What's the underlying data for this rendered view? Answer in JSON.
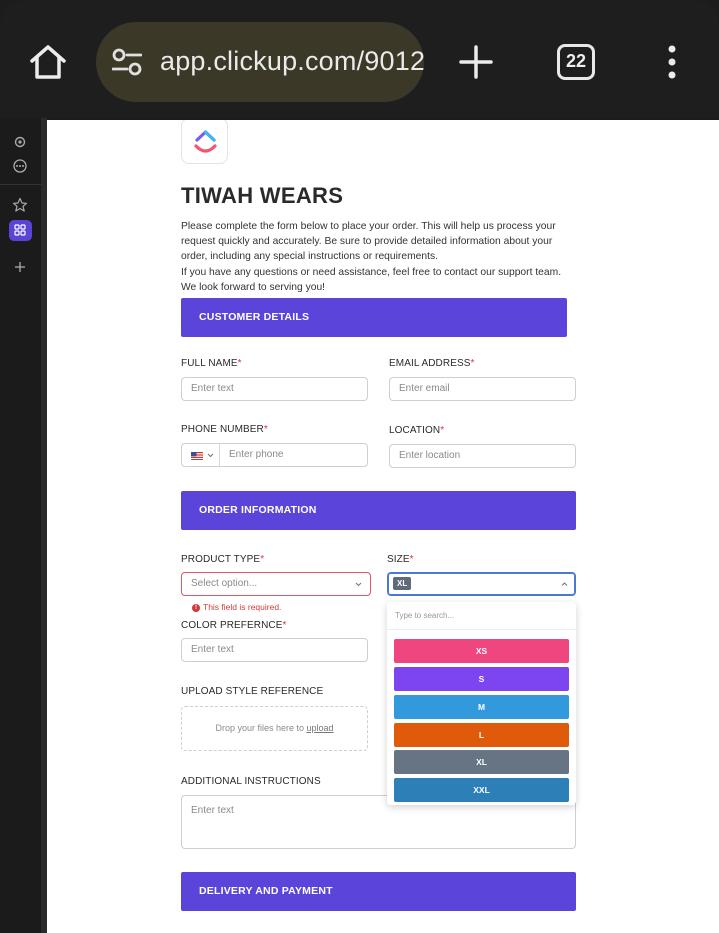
{
  "browser": {
    "url": "app.clickup.com/9012",
    "tab_count": "22"
  },
  "form": {
    "title": "TIWAH WEARS",
    "description": [
      "Please complete the form below to place your order. This will help us process your request quickly and accurately. Be sure to provide detailed information about your order, including any special instructions or requirements.",
      "If you have any questions or need assistance, feel free to contact our support team. We look forward to serving you!"
    ],
    "sections": {
      "customer": "CUSTOMER DETAILS",
      "order": "ORDER INFORMATION",
      "delivery": "DELIVERY AND PAYMENT"
    },
    "required_mark": "*",
    "fields": {
      "full_name": {
        "label": "FULL NAME",
        "placeholder": "Enter text"
      },
      "email": {
        "label": "EMAIL ADDRESS",
        "placeholder": "Enter email"
      },
      "phone": {
        "label": "PHONE NUMBER",
        "placeholder": "Enter phone"
      },
      "location": {
        "label": "LOCATION",
        "placeholder": "Enter location"
      },
      "product_type": {
        "label": "PRODUCT TYPE",
        "placeholder": "Select option...",
        "error": "This field is required."
      },
      "size": {
        "label": "SIZE",
        "selected": "XL",
        "search_placeholder": "Type to search..."
      },
      "color": {
        "label": "COLOR PREFERNCE",
        "placeholder": "Enter text"
      },
      "upload": {
        "label": "UPLOAD STYLE REFERENCE",
        "text": "Drop your files here to ",
        "link": "upload"
      },
      "instructions": {
        "label": "ADDITIONAL INSTRUCTIONS",
        "placeholder": "Enter text"
      }
    },
    "size_options": [
      {
        "label": "XS",
        "color": "#f0467f"
      },
      {
        "label": "S",
        "color": "#7c45f0"
      },
      {
        "label": "M",
        "color": "#3399dd"
      },
      {
        "label": "L",
        "color": "#e05a0c"
      },
      {
        "label": "XL",
        "color": "#667483"
      },
      {
        "label": "XXL",
        "color": "#2d7fb8"
      }
    ]
  },
  "colors": {
    "accent": "#5b44d9",
    "error": "#d23a3a"
  }
}
